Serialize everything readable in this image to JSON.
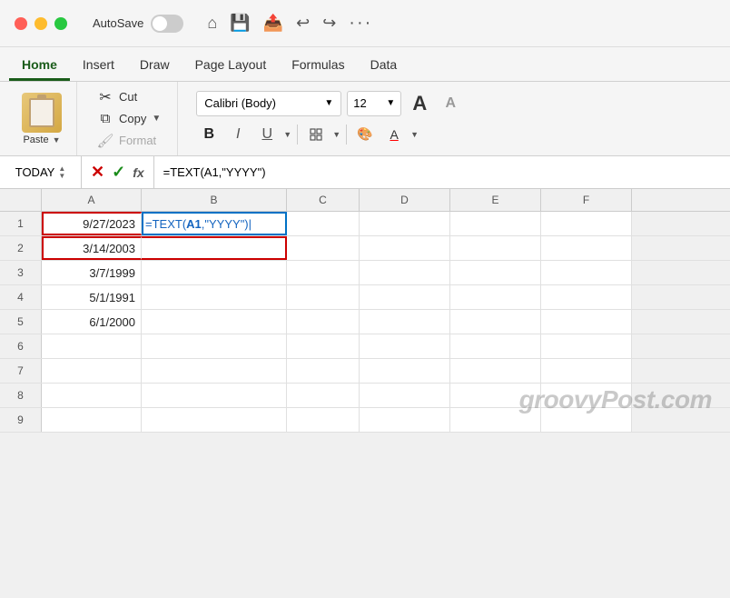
{
  "titlebar": {
    "autosave_label": "AutoSave",
    "icons": [
      "home",
      "save",
      "cloud-save",
      "undo",
      "redo",
      "more"
    ]
  },
  "tabs": [
    {
      "label": "Home",
      "active": true
    },
    {
      "label": "Insert",
      "active": false
    },
    {
      "label": "Draw",
      "active": false
    },
    {
      "label": "Page Layout",
      "active": false
    },
    {
      "label": "Formulas",
      "active": false
    },
    {
      "label": "Data",
      "active": false
    }
  ],
  "clipboard": {
    "paste_label": "Paste",
    "cut_label": "Cut",
    "copy_label": "Copy",
    "format_label": "Format"
  },
  "font": {
    "family": "Calibri (Body)",
    "size": "12",
    "bold": "B",
    "italic": "I",
    "underline": "U"
  },
  "formula_bar": {
    "name_box": "TODAY",
    "formula": "=TEXT(A1,\"YYYY\")"
  },
  "spreadsheet": {
    "col_headers": [
      "A",
      "B",
      "C",
      "D",
      "E",
      "F"
    ],
    "rows": [
      {
        "num": "1",
        "cells": [
          "9/27/2023",
          "=TEXT(A1,\"YYYY\")",
          "",
          "",
          "",
          ""
        ]
      },
      {
        "num": "2",
        "cells": [
          "3/14/2003",
          "",
          "",
          "",
          "",
          ""
        ]
      },
      {
        "num": "3",
        "cells": [
          "3/7/1999",
          "",
          "",
          "",
          "",
          ""
        ]
      },
      {
        "num": "4",
        "cells": [
          "5/1/1991",
          "",
          "",
          "",
          "",
          ""
        ]
      },
      {
        "num": "5",
        "cells": [
          "6/1/2000",
          "",
          "",
          "",
          "",
          ""
        ]
      },
      {
        "num": "6",
        "cells": [
          "",
          "",
          "",
          "",
          "",
          ""
        ]
      },
      {
        "num": "7",
        "cells": [
          "",
          "",
          "",
          "",
          "",
          ""
        ]
      },
      {
        "num": "8",
        "cells": [
          "",
          "",
          "",
          "",
          "",
          ""
        ]
      },
      {
        "num": "9",
        "cells": [
          "",
          "",
          "",
          "",
          "",
          ""
        ]
      }
    ]
  },
  "watermark": "groovyPost.com"
}
